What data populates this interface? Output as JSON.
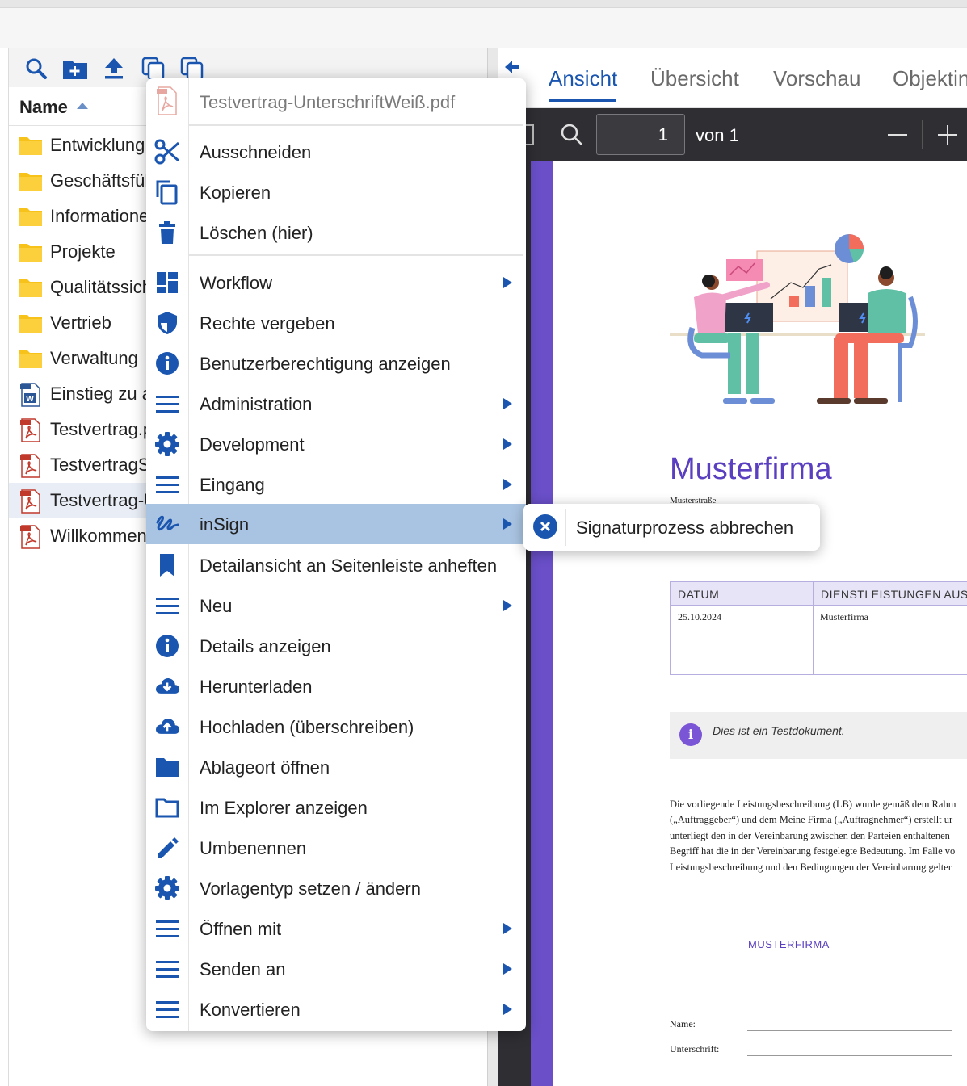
{
  "explorer": {
    "toolbar": [
      "search-icon",
      "new-folder-icon",
      "upload-icon",
      "copy-icon",
      "paste-icon"
    ],
    "column_header": "Name",
    "items": [
      {
        "name": "Entwicklung",
        "type": "folder"
      },
      {
        "name": "Geschäftsfüh",
        "type": "folder"
      },
      {
        "name": "Informatione",
        "type": "folder"
      },
      {
        "name": "Projekte",
        "type": "folder"
      },
      {
        "name": "Qualitätssich",
        "type": "folder"
      },
      {
        "name": "Vertrieb",
        "type": "folder"
      },
      {
        "name": "Verwaltung",
        "type": "folder"
      },
      {
        "name": "Einstieg zu a",
        "type": "docx"
      },
      {
        "name": "Testvertrag.p",
        "type": "pdf"
      },
      {
        "name": "TestvertragS",
        "type": "pdf"
      },
      {
        "name": "Testvertrag-U",
        "type": "pdf",
        "selected": true
      },
      {
        "name": "Willkommen",
        "type": "pdf"
      }
    ]
  },
  "viewer": {
    "tabs": [
      "Ansicht",
      "Übersicht",
      "Vorschau",
      "Objektin"
    ],
    "active_tab": "Ansicht",
    "pdf_toolbar": {
      "page": "1",
      "of_label": "von 1"
    },
    "document": {
      "company": "Musterfirma",
      "street": "Musterstraße",
      "table_headers": [
        "DATUM",
        "DIENSTLEISTUNGEN AUSGI"
      ],
      "table_values": [
        "25.10.2024",
        "Musterfirma"
      ],
      "info_text": "Dies ist ein Testdokument.",
      "paragraph_lines": [
        "Die vorliegende Leistungsbeschreibung (LB) wurde gemäß dem Rahm",
        "(„Auftraggeber“) und dem Meine Firma („Auftragnehmer“) erstellt ur",
        "unterliegt den in der Vereinbarung zwischen den Parteien enthaltenen",
        "Begriff hat die in der Vereinbarung festgelegte Bedeutung. Im Falle vo",
        "Leistungsbeschreibung und den Bedingungen der Vereinbarung gelter"
      ],
      "signature_company": "MUSTERFIRMA",
      "name_label": "Name:",
      "signature_label": "Unterschrift:"
    }
  },
  "context_menu": {
    "title": "Testvertrag-UnterschriftWeiß.pdf",
    "items": [
      {
        "label": "Ausschneiden",
        "icon": "scissors-icon",
        "submenu": false
      },
      {
        "label": "Kopieren",
        "icon": "copy-icon",
        "submenu": false
      },
      {
        "label": "Löschen (hier)",
        "icon": "trash-icon",
        "submenu": false
      },
      {
        "label": "Workflow",
        "icon": "dashboard-icon",
        "submenu": true
      },
      {
        "label": "Rechte vergeben",
        "icon": "shield-icon",
        "submenu": false
      },
      {
        "label": "Benutzerberechtigung anzeigen",
        "icon": "info-icon",
        "submenu": false
      },
      {
        "label": "Administration",
        "icon": "menu-lines-icon",
        "submenu": true
      },
      {
        "label": "Development",
        "icon": "gear-icon",
        "submenu": true
      },
      {
        "label": "Eingang",
        "icon": "menu-lines-icon",
        "submenu": true
      },
      {
        "label": "inSign",
        "icon": "signature-icon",
        "submenu": true,
        "hover": true
      },
      {
        "label": "Detailansicht an Seitenleiste anheften",
        "icon": "bookmark-icon",
        "submenu": false
      },
      {
        "label": "Neu",
        "icon": "menu-lines-icon",
        "submenu": true
      },
      {
        "label": "Details anzeigen",
        "icon": "info-icon",
        "submenu": false
      },
      {
        "label": "Herunterladen",
        "icon": "cloud-download-icon",
        "submenu": false
      },
      {
        "label": "Hochladen (überschreiben)",
        "icon": "cloud-upload-icon",
        "submenu": false
      },
      {
        "label": "Ablageort öffnen",
        "icon": "folder-filled-icon",
        "submenu": false
      },
      {
        "label": "Im Explorer anzeigen",
        "icon": "folder-outline-icon",
        "submenu": false
      },
      {
        "label": "Umbenennen",
        "icon": "pencil-icon",
        "submenu": false
      },
      {
        "label": "Vorlagentyp setzen / ändern",
        "icon": "gear-icon",
        "submenu": false
      },
      {
        "label": "Öffnen mit",
        "icon": "menu-lines-icon",
        "submenu": true
      },
      {
        "label": "Senden an",
        "icon": "menu-lines-icon",
        "submenu": true
      },
      {
        "label": "Konvertieren",
        "icon": "menu-lines-icon",
        "submenu": true
      }
    ]
  },
  "submenu": {
    "label": "Signaturprozess abbrechen",
    "icon": "cancel-circle-icon"
  },
  "colors": {
    "accent": "#1a56b0",
    "hover": "#a9c4e2",
    "folder": "#f7c31b",
    "pdf": "#c0392b",
    "doc_purple": "#5a3fc0"
  }
}
